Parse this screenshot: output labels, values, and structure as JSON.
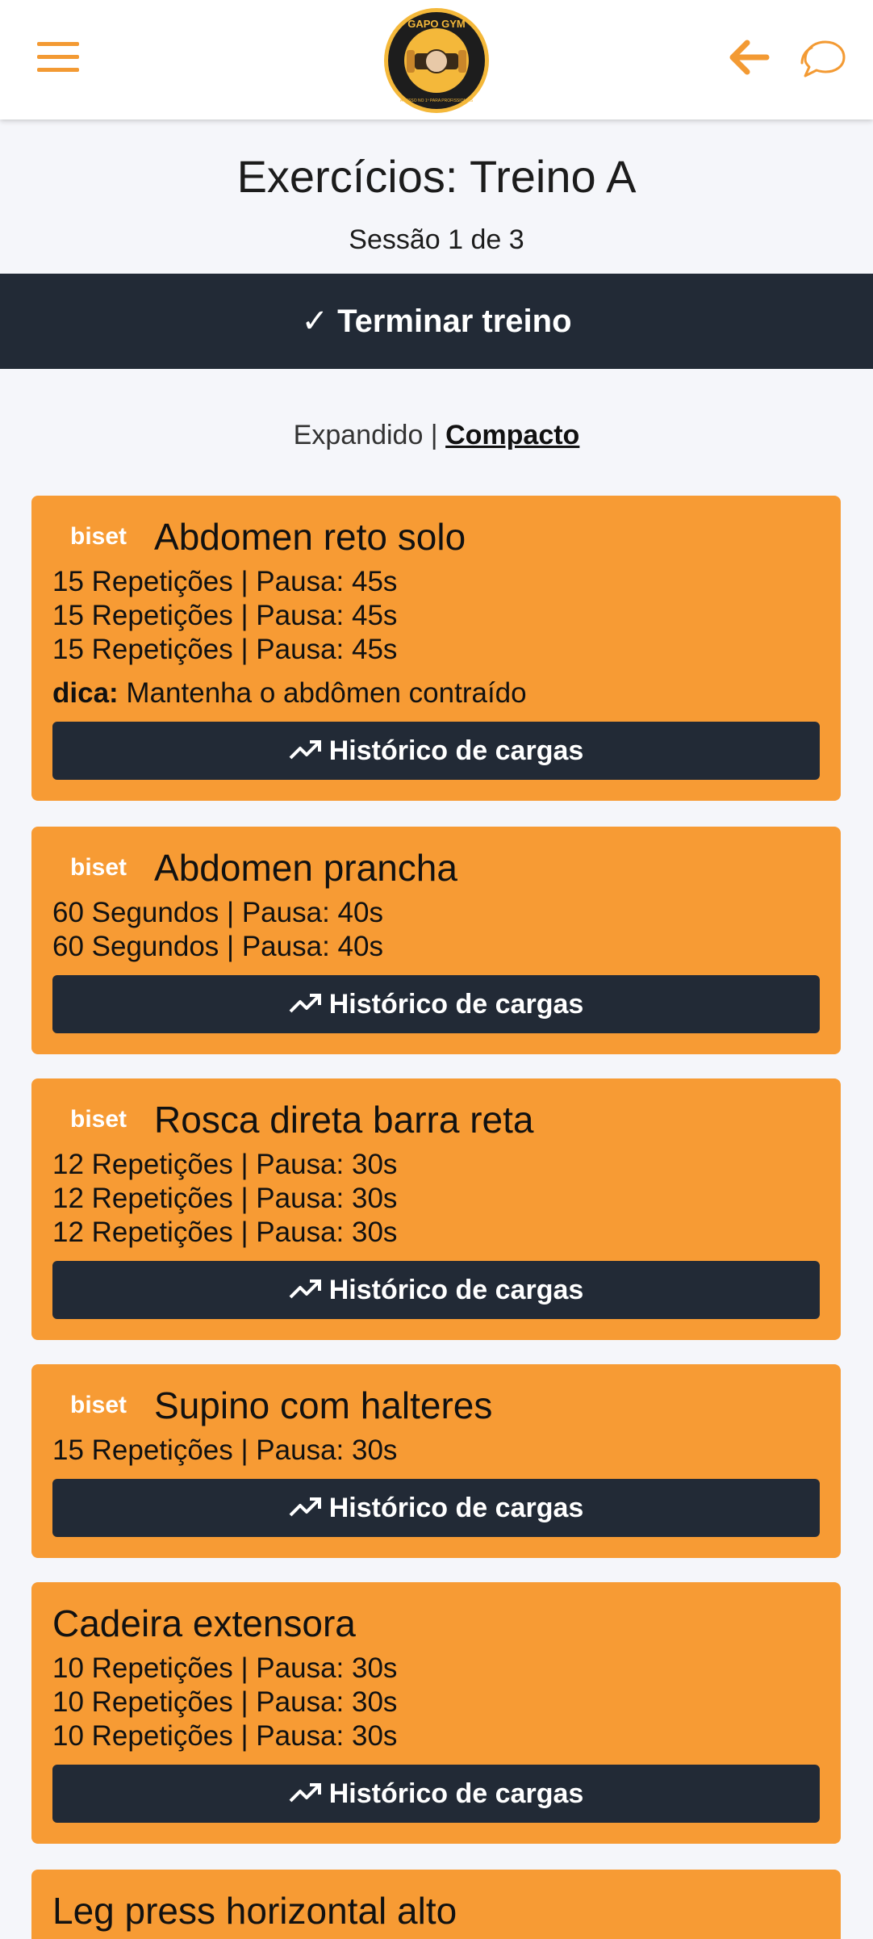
{
  "header": {
    "logo_text_top": "GAPO GYM",
    "logo_text_bottom": "ACESSO NO 1º PARA PROFISSIONAIS"
  },
  "page": {
    "title": "Exercícios: Treino A",
    "session": "Sessão 1 de 3",
    "finish_label": "✓ Terminar treino"
  },
  "view_toggle": {
    "expanded": "Expandido",
    "separator": " | ",
    "compact": "Compacto"
  },
  "history_label": "Histórico de cargas",
  "tip_prefix": "dica:",
  "exercises": [
    {
      "badge": "biset",
      "name": "Abdomen reto solo",
      "sets": [
        "15 Repetições | Pausa: 45s",
        "15 Repetições | Pausa: 45s",
        "15 Repetições | Pausa: 45s"
      ],
      "tip": " Mantenha o abdômen contraído"
    },
    {
      "badge": "biset",
      "name": "Abdomen prancha",
      "sets": [
        "60 Segundos | Pausa: 40s",
        "60 Segundos | Pausa: 40s"
      ]
    },
    {
      "badge": "biset",
      "name": "Rosca direta barra reta",
      "sets": [
        "12 Repetições | Pausa: 30s",
        "12 Repetições | Pausa: 30s",
        "12 Repetições | Pausa: 30s"
      ]
    },
    {
      "badge": "biset",
      "name": "Supino com halteres",
      "sets": [
        "15 Repetições | Pausa: 30s"
      ]
    },
    {
      "badge": "",
      "name": "Cadeira extensora",
      "sets": [
        "10 Repetições | Pausa: 30s",
        "10 Repetições | Pausa: 30s",
        "10 Repetições | Pausa: 30s"
      ]
    },
    {
      "badge": "",
      "name": "Leg press horizontal alto",
      "sets": []
    }
  ],
  "colors": {
    "accent": "#f39a33",
    "card": "#f79b34",
    "dark": "#222a36",
    "background": "#f5f6fa"
  }
}
